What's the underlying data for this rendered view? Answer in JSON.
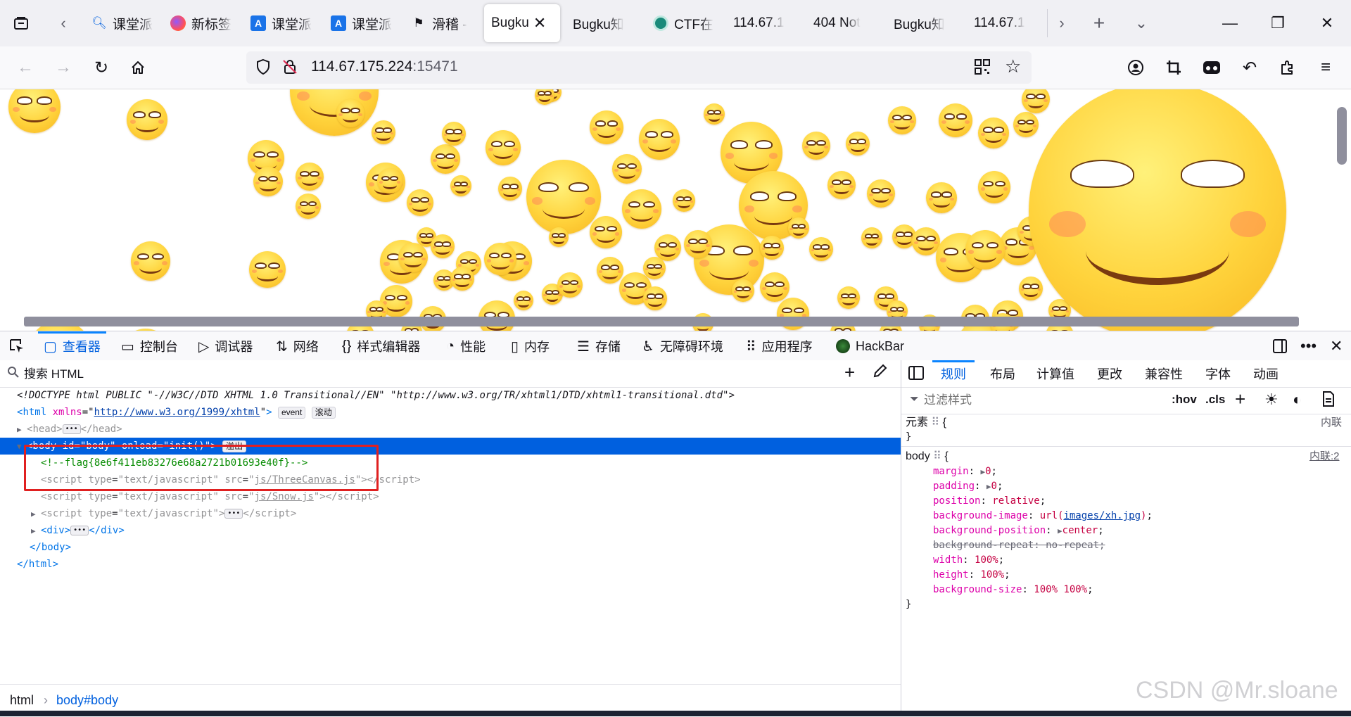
{
  "tabbar": {
    "tabs": [
      {
        "label": "课堂派",
        "icon": "search-icon"
      },
      {
        "label": "新标签",
        "icon": "firefox-icon"
      },
      {
        "label": "课堂派",
        "icon": "translate-icon"
      },
      {
        "label": "课堂派",
        "icon": "translate-icon"
      },
      {
        "label": "滑稽 -",
        "icon": "flag-icon"
      },
      {
        "label": "Bugku",
        "icon": "",
        "active": true
      },
      {
        "label": "Bugku知",
        "icon": ""
      },
      {
        "label": "CTF在",
        "icon": "ctf-icon"
      },
      {
        "label": "114.67.1",
        "icon": ""
      },
      {
        "label": "404 Not",
        "icon": ""
      },
      {
        "label": "Bugku知",
        "icon": ""
      },
      {
        "label": "114.67.1",
        "icon": ""
      }
    ]
  },
  "navbar": {
    "url_host": "114.67.175.224",
    "url_port": ":15471"
  },
  "devtools": {
    "tabs": [
      {
        "label": "查看器",
        "active": true
      },
      {
        "label": "控制台"
      },
      {
        "label": "调试器"
      },
      {
        "label": "网络"
      },
      {
        "label": "样式编辑器"
      },
      {
        "label": "性能"
      },
      {
        "label": "内存"
      },
      {
        "label": "存储"
      },
      {
        "label": "无障碍环境"
      },
      {
        "label": "应用程序"
      },
      {
        "label": "HackBar"
      }
    ],
    "search_placeholder": "搜索 HTML",
    "markup": {
      "doctype": "<!DOCTYPE html PUBLIC \"-//W3C//DTD XHTML 1.0 Transitional//EN\" \"http://www.w3.org/TR/xhtml1/DTD/xhtml1-transitional.dtd\">",
      "html_tag": "html",
      "html_attr": "xmlns",
      "html_attr_value": "http://www.w3.org/1999/xhtml",
      "badge_event": "event",
      "badge_scroll": "滚动",
      "head_tag": "head",
      "body_line": "<body id=\"body\" onload=\"init()\">",
      "body_badge": "溢出",
      "comment": "<!--flag{8e6f411eb83276e68a2721b01693e40f}-->",
      "script1_src": "js/ThreeCanvas.js",
      "script2_src": "js/Snow.js",
      "script_type": "text/javascript"
    },
    "breadcrumbs": [
      "html",
      "body#body"
    ]
  },
  "rules": {
    "tabs": [
      "规则",
      "布局",
      "计算值",
      "更改",
      "兼容性",
      "字体",
      "动画"
    ],
    "filter_placeholder": "过滤样式",
    "hov": ":hov",
    "cls": ".cls",
    "element_label": "元素",
    "inline_label": "内联",
    "body_selector": "body",
    "body_source": "内联:2",
    "declarations": [
      {
        "prop": "margin",
        "value": "0"
      },
      {
        "prop": "padding",
        "value": "0"
      },
      {
        "prop": "position",
        "value": "relative"
      },
      {
        "prop": "background-image",
        "value": "images/xh.jpg"
      },
      {
        "prop": "background-position",
        "value": "center"
      },
      {
        "prop": "background-repeat",
        "value": "no-repeat"
      },
      {
        "prop": "width",
        "value": "100%"
      },
      {
        "prop": "height",
        "value": "100%"
      },
      {
        "prop": "background-size",
        "value": "100% 100%"
      }
    ]
  },
  "watermark": "CSDN @Mr.sloane",
  "colors": {
    "accent": "#0060df",
    "highlight_box": "#e02020",
    "comment": "#058b00"
  }
}
